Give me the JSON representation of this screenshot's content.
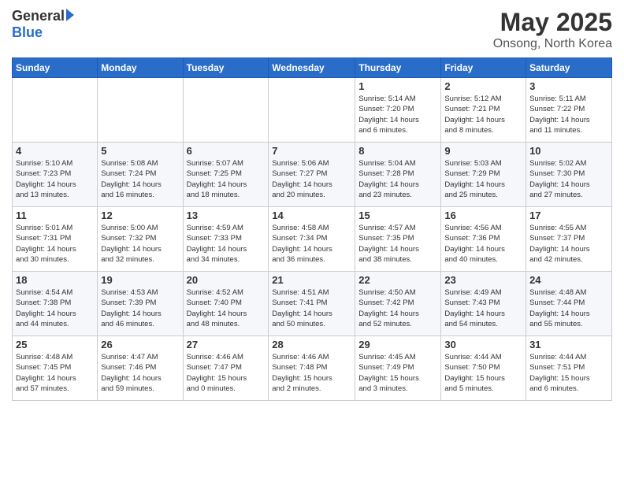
{
  "header": {
    "logo_general": "General",
    "logo_blue": "Blue",
    "month_title": "May 2025",
    "location": "Onsong, North Korea"
  },
  "days_of_week": [
    "Sunday",
    "Monday",
    "Tuesday",
    "Wednesday",
    "Thursday",
    "Friday",
    "Saturday"
  ],
  "weeks": [
    [
      {
        "day": "",
        "info": ""
      },
      {
        "day": "",
        "info": ""
      },
      {
        "day": "",
        "info": ""
      },
      {
        "day": "",
        "info": ""
      },
      {
        "day": "1",
        "info": "Sunrise: 5:14 AM\nSunset: 7:20 PM\nDaylight: 14 hours\nand 6 minutes."
      },
      {
        "day": "2",
        "info": "Sunrise: 5:12 AM\nSunset: 7:21 PM\nDaylight: 14 hours\nand 8 minutes."
      },
      {
        "day": "3",
        "info": "Sunrise: 5:11 AM\nSunset: 7:22 PM\nDaylight: 14 hours\nand 11 minutes."
      }
    ],
    [
      {
        "day": "4",
        "info": "Sunrise: 5:10 AM\nSunset: 7:23 PM\nDaylight: 14 hours\nand 13 minutes."
      },
      {
        "day": "5",
        "info": "Sunrise: 5:08 AM\nSunset: 7:24 PM\nDaylight: 14 hours\nand 16 minutes."
      },
      {
        "day": "6",
        "info": "Sunrise: 5:07 AM\nSunset: 7:25 PM\nDaylight: 14 hours\nand 18 minutes."
      },
      {
        "day": "7",
        "info": "Sunrise: 5:06 AM\nSunset: 7:27 PM\nDaylight: 14 hours\nand 20 minutes."
      },
      {
        "day": "8",
        "info": "Sunrise: 5:04 AM\nSunset: 7:28 PM\nDaylight: 14 hours\nand 23 minutes."
      },
      {
        "day": "9",
        "info": "Sunrise: 5:03 AM\nSunset: 7:29 PM\nDaylight: 14 hours\nand 25 minutes."
      },
      {
        "day": "10",
        "info": "Sunrise: 5:02 AM\nSunset: 7:30 PM\nDaylight: 14 hours\nand 27 minutes."
      }
    ],
    [
      {
        "day": "11",
        "info": "Sunrise: 5:01 AM\nSunset: 7:31 PM\nDaylight: 14 hours\nand 30 minutes."
      },
      {
        "day": "12",
        "info": "Sunrise: 5:00 AM\nSunset: 7:32 PM\nDaylight: 14 hours\nand 32 minutes."
      },
      {
        "day": "13",
        "info": "Sunrise: 4:59 AM\nSunset: 7:33 PM\nDaylight: 14 hours\nand 34 minutes."
      },
      {
        "day": "14",
        "info": "Sunrise: 4:58 AM\nSunset: 7:34 PM\nDaylight: 14 hours\nand 36 minutes."
      },
      {
        "day": "15",
        "info": "Sunrise: 4:57 AM\nSunset: 7:35 PM\nDaylight: 14 hours\nand 38 minutes."
      },
      {
        "day": "16",
        "info": "Sunrise: 4:56 AM\nSunset: 7:36 PM\nDaylight: 14 hours\nand 40 minutes."
      },
      {
        "day": "17",
        "info": "Sunrise: 4:55 AM\nSunset: 7:37 PM\nDaylight: 14 hours\nand 42 minutes."
      }
    ],
    [
      {
        "day": "18",
        "info": "Sunrise: 4:54 AM\nSunset: 7:38 PM\nDaylight: 14 hours\nand 44 minutes."
      },
      {
        "day": "19",
        "info": "Sunrise: 4:53 AM\nSunset: 7:39 PM\nDaylight: 14 hours\nand 46 minutes."
      },
      {
        "day": "20",
        "info": "Sunrise: 4:52 AM\nSunset: 7:40 PM\nDaylight: 14 hours\nand 48 minutes."
      },
      {
        "day": "21",
        "info": "Sunrise: 4:51 AM\nSunset: 7:41 PM\nDaylight: 14 hours\nand 50 minutes."
      },
      {
        "day": "22",
        "info": "Sunrise: 4:50 AM\nSunset: 7:42 PM\nDaylight: 14 hours\nand 52 minutes."
      },
      {
        "day": "23",
        "info": "Sunrise: 4:49 AM\nSunset: 7:43 PM\nDaylight: 14 hours\nand 54 minutes."
      },
      {
        "day": "24",
        "info": "Sunrise: 4:48 AM\nSunset: 7:44 PM\nDaylight: 14 hours\nand 55 minutes."
      }
    ],
    [
      {
        "day": "25",
        "info": "Sunrise: 4:48 AM\nSunset: 7:45 PM\nDaylight: 14 hours\nand 57 minutes."
      },
      {
        "day": "26",
        "info": "Sunrise: 4:47 AM\nSunset: 7:46 PM\nDaylight: 14 hours\nand 59 minutes."
      },
      {
        "day": "27",
        "info": "Sunrise: 4:46 AM\nSunset: 7:47 PM\nDaylight: 15 hours\nand 0 minutes."
      },
      {
        "day": "28",
        "info": "Sunrise: 4:46 AM\nSunset: 7:48 PM\nDaylight: 15 hours\nand 2 minutes."
      },
      {
        "day": "29",
        "info": "Sunrise: 4:45 AM\nSunset: 7:49 PM\nDaylight: 15 hours\nand 3 minutes."
      },
      {
        "day": "30",
        "info": "Sunrise: 4:44 AM\nSunset: 7:50 PM\nDaylight: 15 hours\nand 5 minutes."
      },
      {
        "day": "31",
        "info": "Sunrise: 4:44 AM\nSunset: 7:51 PM\nDaylight: 15 hours\nand 6 minutes."
      }
    ]
  ]
}
